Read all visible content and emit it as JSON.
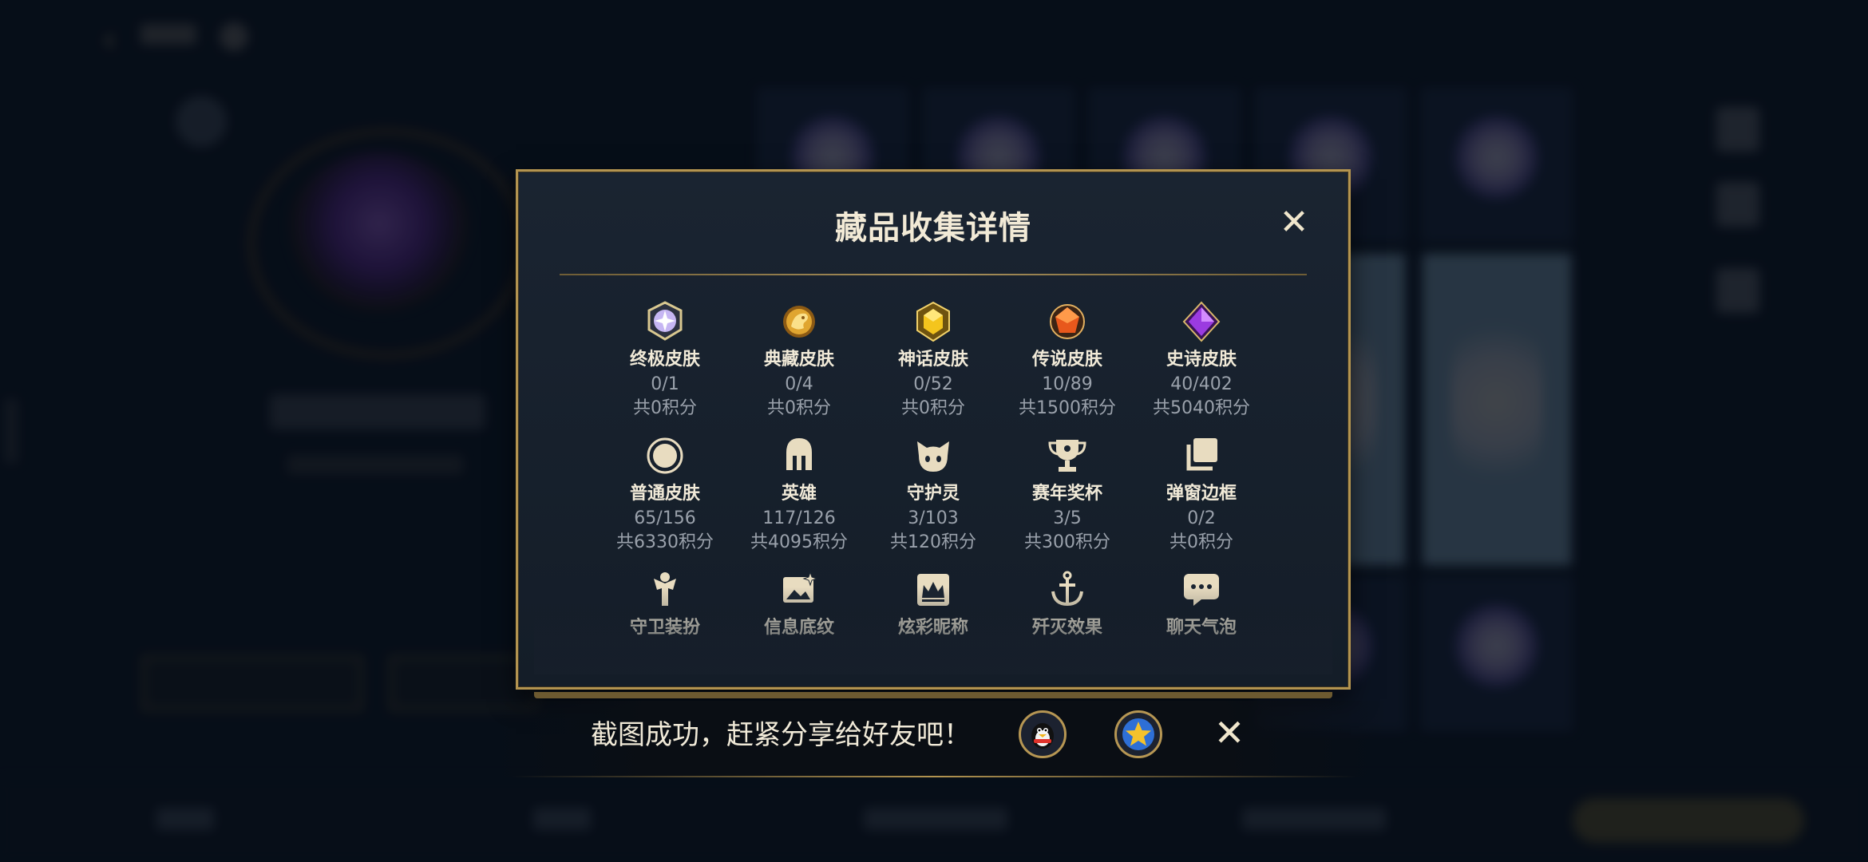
{
  "dialog": {
    "title": "藏品收集详情",
    "close_icon": "close-icon",
    "items": [
      {
        "icon": "ultimate-skin-icon",
        "name": "终极皮肤",
        "count": "0/1",
        "points": "共0积分"
      },
      {
        "icon": "dragon-skin-icon",
        "name": "典藏皮肤",
        "count": "0/4",
        "points": "共0积分"
      },
      {
        "icon": "myth-skin-icon",
        "name": "神话皮肤",
        "count": "0/52",
        "points": "共0积分"
      },
      {
        "icon": "legend-skin-icon",
        "name": "传说皮肤",
        "count": "10/89",
        "points": "共1500积分"
      },
      {
        "icon": "epic-skin-icon",
        "name": "史诗皮肤",
        "count": "40/402",
        "points": "共5040积分"
      },
      {
        "icon": "normal-skin-icon",
        "name": "普通皮肤",
        "count": "65/156",
        "points": "共6330积分"
      },
      {
        "icon": "helmet-icon",
        "name": "英雄",
        "count": "117/126",
        "points": "共4095积分"
      },
      {
        "icon": "guardian-spirit-icon",
        "name": "守护灵",
        "count": "3/103",
        "points": "共120积分"
      },
      {
        "icon": "trophy-icon",
        "name": "赛年奖杯",
        "count": "3/5",
        "points": "共300积分"
      },
      {
        "icon": "popup-frame-icon",
        "name": "弹窗边框",
        "count": "0/2",
        "points": "共0积分"
      },
      {
        "icon": "guard-outfit-icon",
        "name": "守卫装扮",
        "count": "",
        "points": ""
      },
      {
        "icon": "info-pattern-icon",
        "name": "信息底纹",
        "count": "",
        "points": ""
      },
      {
        "icon": "colorful-name-icon",
        "name": "炫彩昵称",
        "count": "",
        "points": ""
      },
      {
        "icon": "annihilate-effect-icon",
        "name": "歼灭效果",
        "count": "",
        "points": ""
      },
      {
        "icon": "chat-bubble-icon",
        "name": "聊天气泡",
        "count": "",
        "points": ""
      }
    ]
  },
  "toast": {
    "text": "截图成功，赶紧分享给好友吧！",
    "share_qq_icon": "qq-penguin-icon",
    "share_zone_icon": "qzone-star-icon",
    "close_icon": "close-icon"
  },
  "colors": {
    "gold": "#b39450",
    "dialog_bg": "#17202b",
    "text_primary": "#f1ead8",
    "text_secondary": "#9aa1ab"
  }
}
